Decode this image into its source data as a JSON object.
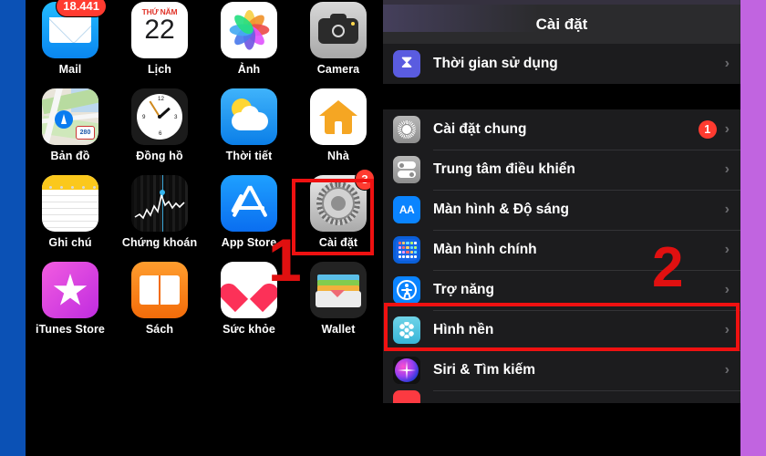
{
  "home_screen": {
    "mail_badge": "18.441",
    "settings_badge": "3",
    "annotation_1": "1",
    "rows": [
      [
        {
          "label": "Mail",
          "icon": "mail-icon"
        },
        {
          "label": "Lịch",
          "icon": "calendar-icon",
          "cal_top": "THỨ NĂM",
          "cal_day": "22"
        },
        {
          "label": "Ảnh",
          "icon": "photos-icon"
        },
        {
          "label": "Camera",
          "icon": "camera-icon"
        }
      ],
      [
        {
          "label": "Bản đồ",
          "icon": "maps-icon",
          "shield": "280"
        },
        {
          "label": "Đồng hồ",
          "icon": "clock-icon"
        },
        {
          "label": "Thời tiết",
          "icon": "weather-icon"
        },
        {
          "label": "Nhà",
          "icon": "home-icon"
        }
      ],
      [
        {
          "label": "Ghi chú",
          "icon": "notes-icon"
        },
        {
          "label": "Chứng khoán",
          "icon": "stocks-icon"
        },
        {
          "label": "App Store",
          "icon": "appstore-icon"
        },
        {
          "label": "Cài đặt",
          "icon": "settings-icon"
        }
      ],
      [
        {
          "label": "iTunes Store",
          "icon": "itunes-icon"
        },
        {
          "label": "Sách",
          "icon": "books-icon"
        },
        {
          "label": "Sức khỏe",
          "icon": "health-icon"
        },
        {
          "label": "Wallet",
          "icon": "wallet-icon"
        }
      ]
    ]
  },
  "settings": {
    "title": "Cài đặt",
    "annotation_2": "2",
    "chevron": "›",
    "groups": [
      {
        "rows": [
          {
            "label": "Thời gian sử dụng",
            "icon": "screentime-icon",
            "badge": null
          }
        ]
      },
      {
        "rows": [
          {
            "label": "Cài đặt chung",
            "icon": "gear-icon",
            "badge": "1"
          },
          {
            "label": "Trung tâm điều khiển",
            "icon": "control-center-icon",
            "badge": null
          },
          {
            "label": "Màn hình & Độ sáng",
            "icon": "display-brightness-icon",
            "badge": null,
            "icon_text": "AA"
          },
          {
            "label": "Màn hình chính",
            "icon": "home-screen-icon",
            "badge": null
          },
          {
            "label": "Trợ năng",
            "icon": "accessibility-icon",
            "badge": null,
            "highlighted": true
          },
          {
            "label": "Hình nền",
            "icon": "wallpaper-icon",
            "badge": null
          },
          {
            "label": "Siri & Tìm kiếm",
            "icon": "siri-icon",
            "badge": null
          }
        ]
      }
    ]
  },
  "colors": {
    "left_edge": "#0b51b5",
    "right_edge": "#c164e0",
    "highlight_red": "#ef1111",
    "annotation_red": "#e01010",
    "badge_red": "#ff3b30",
    "row_bg": "#1c1c1e",
    "header_bg": "#2b2b2d"
  }
}
